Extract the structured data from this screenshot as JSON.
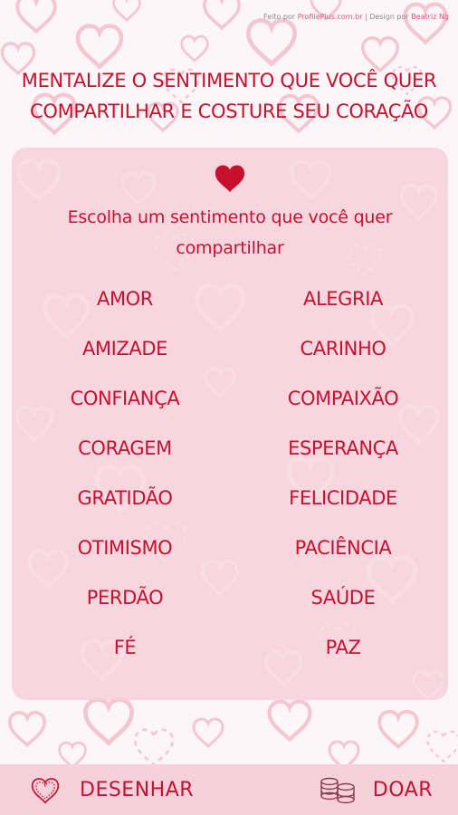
{
  "credit": {
    "prefix": "Feito por",
    "site": "ProfilePlus.com.br",
    "separator": "|",
    "design_prefix": "Design por",
    "designer": "Beatriz Ng"
  },
  "headline": {
    "line1": "MENTALIZE O SENTIMENTO QUE VOCÊ QUER",
    "line2": "COMPARTILHAR E COSTURE SEU CORAÇÃO"
  },
  "panel": {
    "icon": "heart-icon",
    "prompt_line1": "Escolha um sentimento que você quer",
    "prompt_line2": "compartilhar",
    "feelings": [
      "AMOR",
      "ALEGRIA",
      "AMIZADE",
      "CARINHO",
      "CONFIANÇA",
      "COMPAIXÃO",
      "CORAGEM",
      "ESPERANÇA",
      "GRATIDÃO",
      "FELICIDADE",
      "OTIMISMO",
      "PACIÊNCIA",
      "PERDÃO",
      "SAÚDE",
      "FÉ",
      "PAZ"
    ]
  },
  "bottom_bar": {
    "draw_label": "DESENHAR",
    "draw_icon": "stitched-heart-icon",
    "donate_label": "DOAR",
    "donate_icon": "coins-icon"
  },
  "colors": {
    "accent": "#c8102e",
    "panel": "#f7ceda",
    "background": "#fdf6f8",
    "bottom_bar": "#f6d1dc"
  }
}
